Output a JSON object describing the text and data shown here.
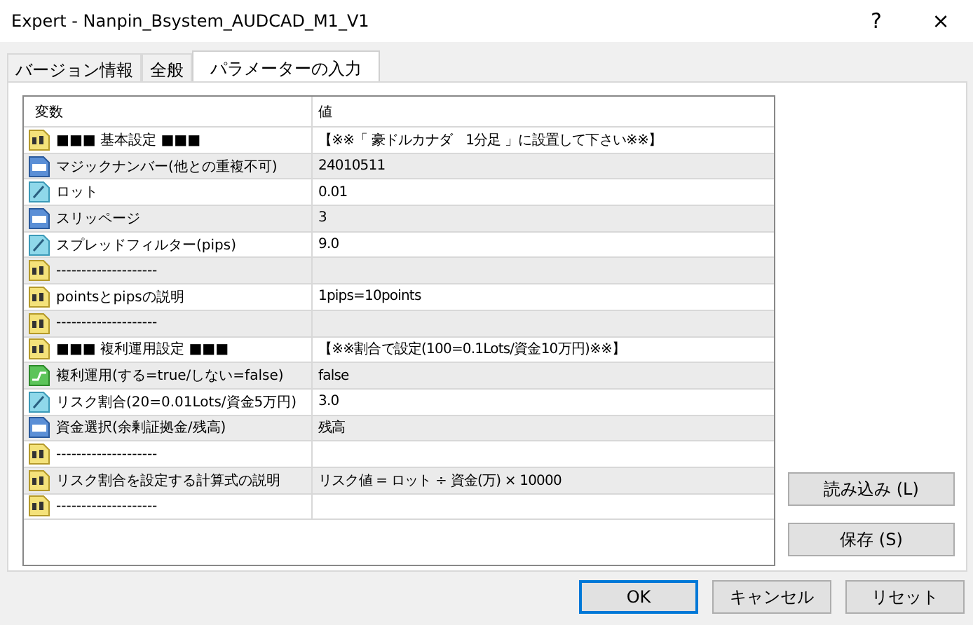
{
  "window": {
    "title": "Expert - Nanpin_Bsystem_AUDCAD_M1_V1",
    "help": "?",
    "close": "×"
  },
  "tabs": [
    {
      "label": "バージョン情報",
      "selected": false
    },
    {
      "label": "全般",
      "selected": false
    },
    {
      "label": "パラメーターの入力",
      "selected": true
    }
  ],
  "table": {
    "columns": [
      "変数",
      "値"
    ],
    "rows": [
      {
        "kind": "text",
        "name": "■■■ 基本設定 ■■■",
        "value": "【※※「 豪ドルカナダ　1分足 」に設置して下さい※※】"
      },
      {
        "kind": "integer",
        "name": "マジックナンバー(他との重複不可)",
        "value": "24010511"
      },
      {
        "kind": "decimal",
        "name": "ロット",
        "value": "0.01"
      },
      {
        "kind": "integer",
        "name": "スリッページ",
        "value": "3"
      },
      {
        "kind": "decimal",
        "name": "スプレッドフィルター(pips)",
        "value": "9.0"
      },
      {
        "kind": "text",
        "name": "--------------------"
      },
      {
        "kind": "text",
        "name": "pointsとpipsの説明",
        "value": "1pips=10points"
      },
      {
        "kind": "text",
        "name": "--------------------"
      },
      {
        "kind": "text",
        "name": "■■■ 複利運用設定 ■■■",
        "value": "【※※割合で設定(100=0.1Lots/資金10万円)※※】"
      },
      {
        "kind": "boolean",
        "name": "複利運用(する=true/しない=false)",
        "value": "false"
      },
      {
        "kind": "decimal",
        "name": "リスク割合(20=0.01Lots/資金5万円)",
        "value": "3.0"
      },
      {
        "kind": "integer",
        "name": "資金選択(余剰証拠金/残高)",
        "value": "残高"
      },
      {
        "kind": "text",
        "name": "--------------------"
      },
      {
        "kind": "text",
        "name": "リスク割合を設定する計算式の説明",
        "value": "リスク値 = ロット ÷ 資金(万) × 10000"
      },
      {
        "kind": "text",
        "name": "--------------------"
      }
    ]
  },
  "side_buttons": [
    "読み込み (L)",
    "保存 (S)"
  ],
  "buttons": [
    {
      "label": "OK",
      "default": true
    },
    {
      "label": "キャンセル",
      "default": false
    },
    {
      "label": "リセット",
      "default": false
    }
  ]
}
